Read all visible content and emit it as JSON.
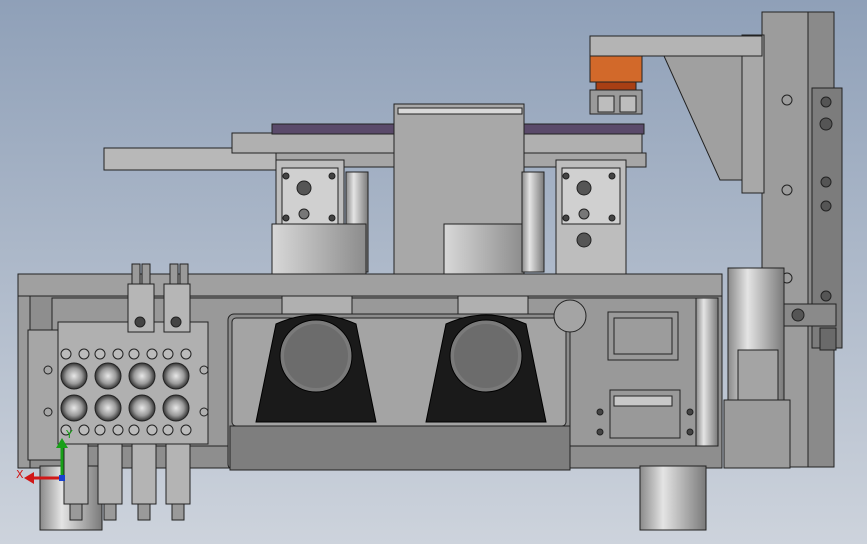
{
  "viewport": {
    "background_top": "#8fa0b8",
    "background_bottom": "#cdd3dc"
  },
  "colors": {
    "metal_light": "#c8c8c8",
    "metal_mid": "#9a9a9a",
    "metal_dark": "#6a6a6a",
    "black_part": "#1a1a1a",
    "orange_part": "#d2692a",
    "purple_plate": "#5a4a6a",
    "outline": "#222222",
    "axis_x": "#d01818",
    "axis_y": "#18a018",
    "axis_z": "#1840d0"
  },
  "triad": {
    "x_label": "X",
    "y_label": "Y"
  }
}
